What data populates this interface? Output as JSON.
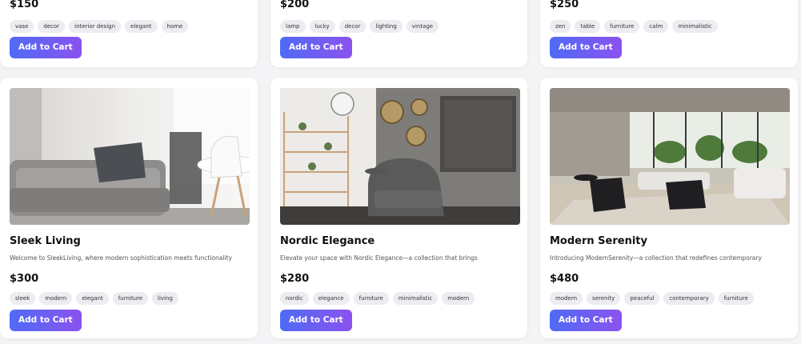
{
  "button_label": "Add to Cart",
  "accent_gradient": [
    "#4f6bf5",
    "#8b52f0"
  ],
  "top_row": [
    {
      "price": "$150",
      "tags": [
        "vase",
        "decor",
        "interior design",
        "elegant",
        "home"
      ]
    },
    {
      "price": "$200",
      "tags": [
        "lamp",
        "lucky",
        "decor",
        "lighting",
        "vintage"
      ]
    },
    {
      "price": "$250",
      "tags": [
        "zen",
        "table",
        "furniture",
        "calm",
        "minimalistic"
      ]
    }
  ],
  "bottom_row": [
    {
      "title": "Sleek Living",
      "description": "Welcome to SleekLiving, where modern sophistication meets functionality",
      "price": "$300",
      "tags": [
        "sleek",
        "modern",
        "elegant",
        "furniture",
        "living"
      ]
    },
    {
      "title": "Nordic Elegance",
      "description": "Elevate your space with Nordic Elegance—a collection that brings",
      "price": "$280",
      "tags": [
        "nordic",
        "elegance",
        "furniture",
        "minimalistic",
        "modern"
      ]
    },
    {
      "title": "Modern Serenity",
      "description": "Introducing ModernSerenity—a collection that redefines contemporary",
      "price": "$480",
      "tags": [
        "modern",
        "serenity",
        "peaceful",
        "contemporary",
        "furniture"
      ]
    }
  ]
}
